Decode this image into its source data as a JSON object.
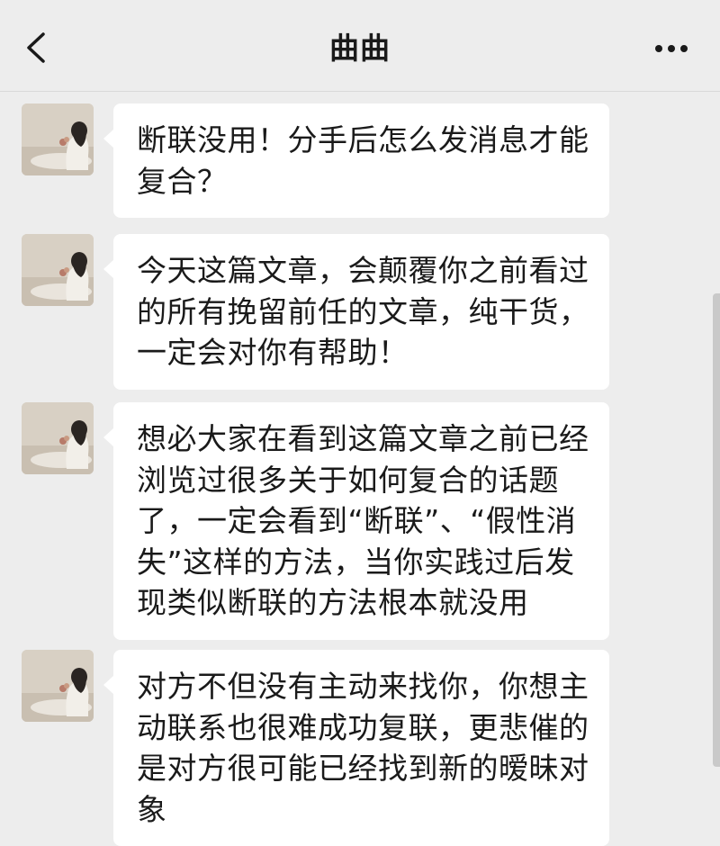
{
  "header": {
    "title": "曲曲",
    "back_icon": "chevron-left-icon",
    "more_icon": "more-dots-icon"
  },
  "messages": [
    {
      "sender": "曲曲",
      "text": "断联没用！分手后怎么发消息才能复合？"
    },
    {
      "sender": "曲曲",
      "text": "今天这篇文章，会颠覆你之前看过的所有挽留前任的文章，纯干货，一定会对你有帮助！"
    },
    {
      "sender": "曲曲",
      "text": "想必大家在看到这篇文章之前已经浏览过很多关于如何复合的话题了，一定会看到“断联”、“假性消失”这样的方法，当你实践过后发现类似断联的方法根本就没用"
    },
    {
      "sender": "曲曲",
      "text": "对方不但没有主动来找你，你想主动联系也很难成功复联，更悲催的是对方很可能已经找到新的暧昧对象"
    }
  ],
  "colors": {
    "background": "#ededed",
    "bubble": "#ffffff",
    "text": "#1a1a1a"
  }
}
